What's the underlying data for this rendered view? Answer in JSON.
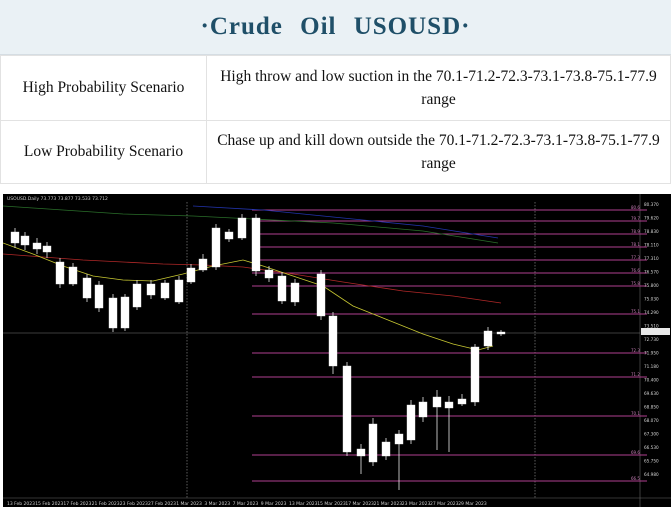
{
  "title": "·Crude  Oil  USOUSD·",
  "scenarios": [
    {
      "label": "High Probability Scenario",
      "desc": "High throw and low suction in the 70.1-71.2-72.3-73.1-73.8-75.1-77.9 range"
    },
    {
      "label": "Low Probability Scenario",
      "desc": "Chase up and kill down outside the 70.1-71.2-72.3-73.1-73.8-75.1-77.9 range"
    }
  ],
  "chart_data": {
    "type": "candlestick",
    "symbol_header": "USOUSD.Daily  73.773 73.877 73.533 73.712",
    "price_labels": [
      "80.370",
      "79.620",
      "78.830",
      "78.110",
      "77.310",
      "76.570",
      "75.800",
      "75.030",
      "74.290",
      "73.510",
      "72.730",
      "71.950",
      "71.180",
      "70.400",
      "69.630",
      "68.850",
      "68.070",
      "67.300",
      "66.530",
      "65.750",
      "64.980"
    ],
    "date_labels": [
      "13 Feb 2023",
      "15 Feb 2023",
      "17 Feb 2023",
      "21 Feb 2023",
      "23 Feb 2023",
      "27 Feb 2023",
      "1 Mar 2023",
      "3 Mar 2023",
      "7 Mar 2023",
      "9 Mar 2023",
      "13 Mar 2023",
      "15 Mar 2023",
      "17 Mar 2023",
      "21 Mar 2023",
      "23 Mar 2023",
      "27 Mar 2023",
      "29 Mar 2023"
    ],
    "level_labels": [
      "80.6",
      "79.7",
      "78.9",
      "78.1",
      "77.3",
      "76.6",
      "75.8",
      "75.1",
      "72.3",
      "71.2",
      "70.1",
      "69.6",
      "66.5",
      "65.1"
    ],
    "colors": {
      "background": "#000000",
      "candle_up": "#ffffff",
      "candle_down": "#ffffff",
      "level_line": "#b0408f",
      "ma_fast": "#c8c832",
      "ma_slow": "#b02828",
      "ma_long": "#2a6e2a",
      "ma_blue": "#2233aa"
    }
  }
}
